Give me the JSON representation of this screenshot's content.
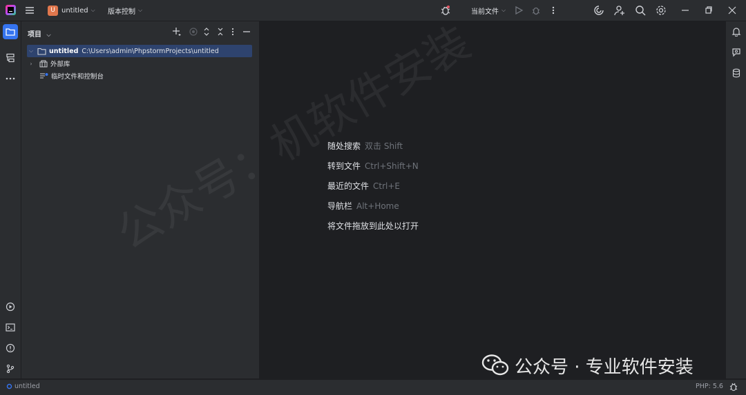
{
  "titlebar": {
    "project_initial": "U",
    "project_name": "untitled",
    "vcs_label": "版本控制",
    "run_config": "当前文件"
  },
  "project_panel": {
    "title": "项目",
    "tree": [
      {
        "name": "untitled",
        "path": "C:\\Users\\admin\\PhpstormProjects\\untitled",
        "selected": true
      },
      {
        "name": "外部库"
      },
      {
        "name": "临时文件和控制台"
      }
    ]
  },
  "editor": {
    "hints": [
      {
        "action": "随处搜索",
        "shortcut": "双击 Shift"
      },
      {
        "action": "转到文件",
        "shortcut": "Ctrl+Shift+N"
      },
      {
        "action": "最近的文件",
        "shortcut": "Ctrl+E"
      },
      {
        "action": "导航栏",
        "shortcut": "Alt+Home"
      },
      {
        "action": "将文件拖放到此处以打开",
        "shortcut": ""
      }
    ]
  },
  "watermarks": {
    "diagonal": "公众号：机软件安装",
    "corner": "公众号 · 专业软件安装"
  },
  "statusbar": {
    "project": "untitled",
    "php_version": "PHP: 5.6"
  },
  "colors": {
    "accent": "#3574f0",
    "selection": "#2e436e",
    "project_badge": "#e0774d",
    "background": "#1e1f22",
    "panel": "#2b2d30"
  }
}
